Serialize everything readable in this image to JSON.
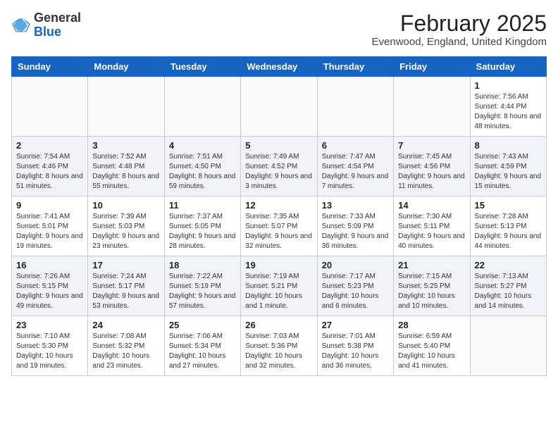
{
  "header": {
    "logo": {
      "general": "General",
      "blue": "Blue"
    },
    "title": "February 2025",
    "location": "Evenwood, England, United Kingdom"
  },
  "weekdays": [
    "Sunday",
    "Monday",
    "Tuesday",
    "Wednesday",
    "Thursday",
    "Friday",
    "Saturday"
  ],
  "weeks": [
    [
      {
        "day": "",
        "info": ""
      },
      {
        "day": "",
        "info": ""
      },
      {
        "day": "",
        "info": ""
      },
      {
        "day": "",
        "info": ""
      },
      {
        "day": "",
        "info": ""
      },
      {
        "day": "",
        "info": ""
      },
      {
        "day": "1",
        "info": "Sunrise: 7:56 AM\nSunset: 4:44 PM\nDaylight: 8 hours and 48 minutes."
      }
    ],
    [
      {
        "day": "2",
        "info": "Sunrise: 7:54 AM\nSunset: 4:46 PM\nDaylight: 8 hours and 51 minutes."
      },
      {
        "day": "3",
        "info": "Sunrise: 7:52 AM\nSunset: 4:48 PM\nDaylight: 8 hours and 55 minutes."
      },
      {
        "day": "4",
        "info": "Sunrise: 7:51 AM\nSunset: 4:50 PM\nDaylight: 8 hours and 59 minutes."
      },
      {
        "day": "5",
        "info": "Sunrise: 7:49 AM\nSunset: 4:52 PM\nDaylight: 9 hours and 3 minutes."
      },
      {
        "day": "6",
        "info": "Sunrise: 7:47 AM\nSunset: 4:54 PM\nDaylight: 9 hours and 7 minutes."
      },
      {
        "day": "7",
        "info": "Sunrise: 7:45 AM\nSunset: 4:56 PM\nDaylight: 9 hours and 11 minutes."
      },
      {
        "day": "8",
        "info": "Sunrise: 7:43 AM\nSunset: 4:59 PM\nDaylight: 9 hours and 15 minutes."
      }
    ],
    [
      {
        "day": "9",
        "info": "Sunrise: 7:41 AM\nSunset: 5:01 PM\nDaylight: 9 hours and 19 minutes."
      },
      {
        "day": "10",
        "info": "Sunrise: 7:39 AM\nSunset: 5:03 PM\nDaylight: 9 hours and 23 minutes."
      },
      {
        "day": "11",
        "info": "Sunrise: 7:37 AM\nSunset: 5:05 PM\nDaylight: 9 hours and 28 minutes."
      },
      {
        "day": "12",
        "info": "Sunrise: 7:35 AM\nSunset: 5:07 PM\nDaylight: 9 hours and 32 minutes."
      },
      {
        "day": "13",
        "info": "Sunrise: 7:33 AM\nSunset: 5:09 PM\nDaylight: 9 hours and 36 minutes."
      },
      {
        "day": "14",
        "info": "Sunrise: 7:30 AM\nSunset: 5:11 PM\nDaylight: 9 hours and 40 minutes."
      },
      {
        "day": "15",
        "info": "Sunrise: 7:28 AM\nSunset: 5:13 PM\nDaylight: 9 hours and 44 minutes."
      }
    ],
    [
      {
        "day": "16",
        "info": "Sunrise: 7:26 AM\nSunset: 5:15 PM\nDaylight: 9 hours and 49 minutes."
      },
      {
        "day": "17",
        "info": "Sunrise: 7:24 AM\nSunset: 5:17 PM\nDaylight: 9 hours and 53 minutes."
      },
      {
        "day": "18",
        "info": "Sunrise: 7:22 AM\nSunset: 5:19 PM\nDaylight: 9 hours and 57 minutes."
      },
      {
        "day": "19",
        "info": "Sunrise: 7:19 AM\nSunset: 5:21 PM\nDaylight: 10 hours and 1 minute."
      },
      {
        "day": "20",
        "info": "Sunrise: 7:17 AM\nSunset: 5:23 PM\nDaylight: 10 hours and 6 minutes."
      },
      {
        "day": "21",
        "info": "Sunrise: 7:15 AM\nSunset: 5:25 PM\nDaylight: 10 hours and 10 minutes."
      },
      {
        "day": "22",
        "info": "Sunrise: 7:13 AM\nSunset: 5:27 PM\nDaylight: 10 hours and 14 minutes."
      }
    ],
    [
      {
        "day": "23",
        "info": "Sunrise: 7:10 AM\nSunset: 5:30 PM\nDaylight: 10 hours and 19 minutes."
      },
      {
        "day": "24",
        "info": "Sunrise: 7:08 AM\nSunset: 5:32 PM\nDaylight: 10 hours and 23 minutes."
      },
      {
        "day": "25",
        "info": "Sunrise: 7:06 AM\nSunset: 5:34 PM\nDaylight: 10 hours and 27 minutes."
      },
      {
        "day": "26",
        "info": "Sunrise: 7:03 AM\nSunset: 5:36 PM\nDaylight: 10 hours and 32 minutes."
      },
      {
        "day": "27",
        "info": "Sunrise: 7:01 AM\nSunset: 5:38 PM\nDaylight: 10 hours and 36 minutes."
      },
      {
        "day": "28",
        "info": "Sunrise: 6:59 AM\nSunset: 5:40 PM\nDaylight: 10 hours and 41 minutes."
      },
      {
        "day": "",
        "info": ""
      }
    ]
  ]
}
